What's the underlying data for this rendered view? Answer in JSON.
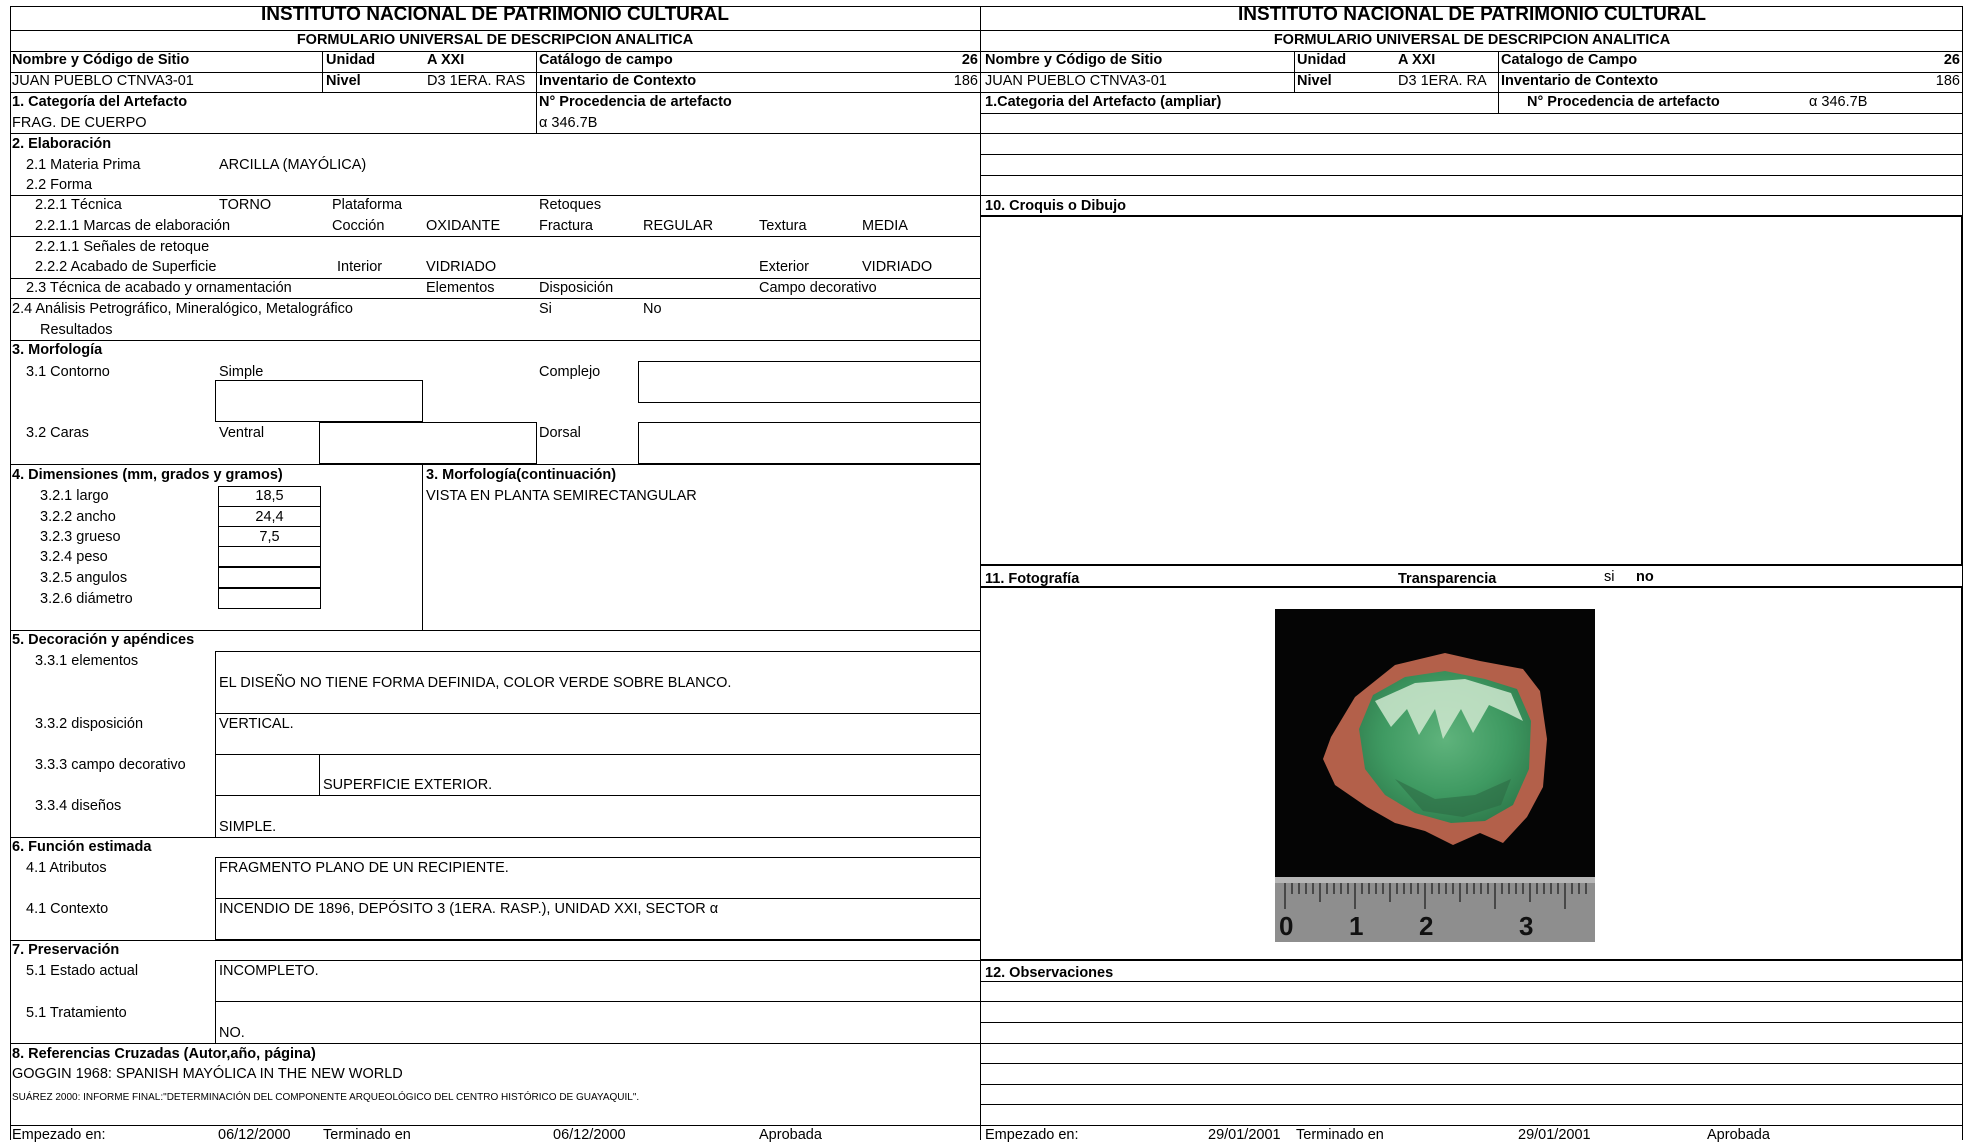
{
  "left": {
    "title": "INSTITUTO NACIONAL DE PATRIMONIO CULTURAL",
    "subtitle": "FORMULARIO UNIVERSAL DE DESCRIPCION ANALITICA",
    "h_site": "Nombre y Código de Sitio",
    "h_unidad": "Unidad",
    "unidad": "A XXI",
    "h_catalogo": "Catálogo de campo",
    "catalogo": "26",
    "site": "JUAN PUEBLO CTNVA3-01",
    "h_nivel": "Nivel",
    "nivel": "D3 1ERA. RAS",
    "h_inventario": "Inventario de Contexto",
    "inventario": "186",
    "h_categoria": "1. Categoría del Artefacto",
    "h_procedencia": "N° Procedencia de artefacto",
    "categoria": "FRAG. DE CUERPO",
    "procedencia": "α 346.7B",
    "h_elaboracion": "2. Elaboración",
    "materia_label": "2.1 Materia Prima",
    "materia": "ARCILLA (MAYÓLICA)",
    "forma_label": "2.2 Forma",
    "tecnica_label": "2.2.1 Técnica",
    "tecnica": "TORNO",
    "plataforma_label": "Plataforma",
    "retoques_label": "Retoques",
    "marcas_label": "2.2.1.1 Marcas de elaboración",
    "coccion_label": "Cocción",
    "coccion": "OXIDANTE",
    "fractura_label": "Fractura",
    "fractura": "REGULAR",
    "textura_label": "Textura",
    "textura": "MEDIA",
    "senales_label": "2.2.1.1 Señales de retoque",
    "acabado_label": "2.2.2 Acabado de Superficie",
    "interior_label": "Interior",
    "interior": "VIDRIADO",
    "exterior_label": "Exterior",
    "exterior": "VIDRIADO",
    "tecnica_acabado_label": "2.3 Técnica de acabado y ornamentación",
    "elementos_label": "Elementos",
    "disposicion_label": "Disposición",
    "campo_label": "Campo decorativo",
    "analisis_label": "2.4  Análisis Petrográfico, Mineralógico, Metalográfico",
    "si_label": "Si",
    "no_label": "No",
    "resultados_label": "Resultados",
    "h_morfologia": "3.  Morfología",
    "contorno_label": "3.1 Contorno",
    "simple_label": "Simple",
    "complejo_label": "Complejo",
    "caras_label": "3.2 Caras",
    "ventral_label": "Ventral",
    "dorsal_label": "Dorsal",
    "h_dimensiones": "4.  Dimensiones (mm, grados y gramos)",
    "h_morf_cont": "3.  Morfología(continuación)",
    "morf_cont": "VISTA EN PLANTA SEMIRECTANGULAR",
    "dims": [
      {
        "label": "3.2.1 largo",
        "value": "18,5"
      },
      {
        "label": "3.2.2 ancho",
        "value": "24,4"
      },
      {
        "label": "3.2.3 grueso",
        "value": "7,5"
      },
      {
        "label": "3.2.4  peso",
        "value": ""
      },
      {
        "label": "3.2.5 angulos",
        "value": ""
      },
      {
        "label": "3.2.6 diámetro",
        "value": ""
      }
    ],
    "h_decoracion": "5. Decoración y apéndices",
    "elementos2_label": "3.3.1 elementos",
    "elementos2": "EL DISEÑO NO TIENE FORMA DEFINIDA, COLOR VERDE SOBRE BLANCO.",
    "disposicion2_label": "3.3.2 disposición",
    "disposicion2": "VERTICAL.",
    "campo2_label": "3.3.3 campo decorativo",
    "campo2": "SUPERFICIE EXTERIOR.",
    "disenos_label": "3.3.4 diseños",
    "disenos": "SIMPLE.",
    "h_funcion": "6. Función estimada",
    "atributos_label": "4.1 Atributos",
    "atributos": "FRAGMENTO PLANO DE UN RECIPIENTE.",
    "contexto_label": "4.1 Contexto",
    "contexto": "INCENDIO DE 1896, DEPÓSITO 3 (1ERA. RASP.),  UNIDAD XXI, SECTOR α",
    "h_preservacion": "7. Preservación",
    "estado_label": "5.1 Estado actual",
    "estado": "INCOMPLETO.",
    "tratamiento_label": "5.1 Tratamiento",
    "tratamiento": "NO.",
    "h_referencias": "8. Referencias Cruzadas (Autor,año, página)",
    "ref1": "GOGGIN 1968: SPANISH MAYÓLICA IN THE NEW WORLD",
    "ref2": "SUÁREZ 2000: INFORME FINAL:\"DETERMINACIÓN DEL COMPONENTE ARQUEOLÓGICO DEL CENTRO HISTÓRICO DE GUAYAQUIL\".",
    "empezado_label": "Empezado en:",
    "empezado": "06/12/2000",
    "terminado_label": "Terminado en",
    "terminado": "06/12/2000",
    "aprobada_label": "Aprobada"
  },
  "right": {
    "title": "INSTITUTO NACIONAL DE PATRIMONIO CULTURAL",
    "subtitle": "FORMULARIO UNIVERSAL DE DESCRIPCION ANALITICA",
    "h_site": "Nombre y Código de Sitio",
    "h_unidad": "Unidad",
    "unidad": "A XXI",
    "h_catalogo": "Catalogo de Campo",
    "catalogo": "26",
    "site": "JUAN PUEBLO CTNVA3-01",
    "h_nivel": "Nivel",
    "nivel": "D3 1ERA. RA",
    "h_inventario": "Inventario de Contexto",
    "inventario": "186",
    "h_categoria": "1.Categoria del Artefacto (ampliar)",
    "h_procedencia": "N° Procedencia de artefacto",
    "procedencia": "α 346.7B",
    "h_croquis": "10. Croquis o Dibujo",
    "h_fotografia": "11. Fotografía",
    "transparencia_label": "Transparencia",
    "si_label": "si",
    "no_label": "no",
    "h_observaciones": "12. Observaciones",
    "empezado_label": "Empezado en:",
    "empezado": "29/01/2001",
    "terminado_label": "Terminado en",
    "terminado": "29/01/2001",
    "aprobada_label": "Aprobada"
  },
  "photo": {
    "ruler_labels": [
      "0",
      "1",
      "2",
      "3"
    ],
    "fragment_color": "#b3604a",
    "glaze_color": "#3f9a62",
    "background_color": "#050505"
  }
}
